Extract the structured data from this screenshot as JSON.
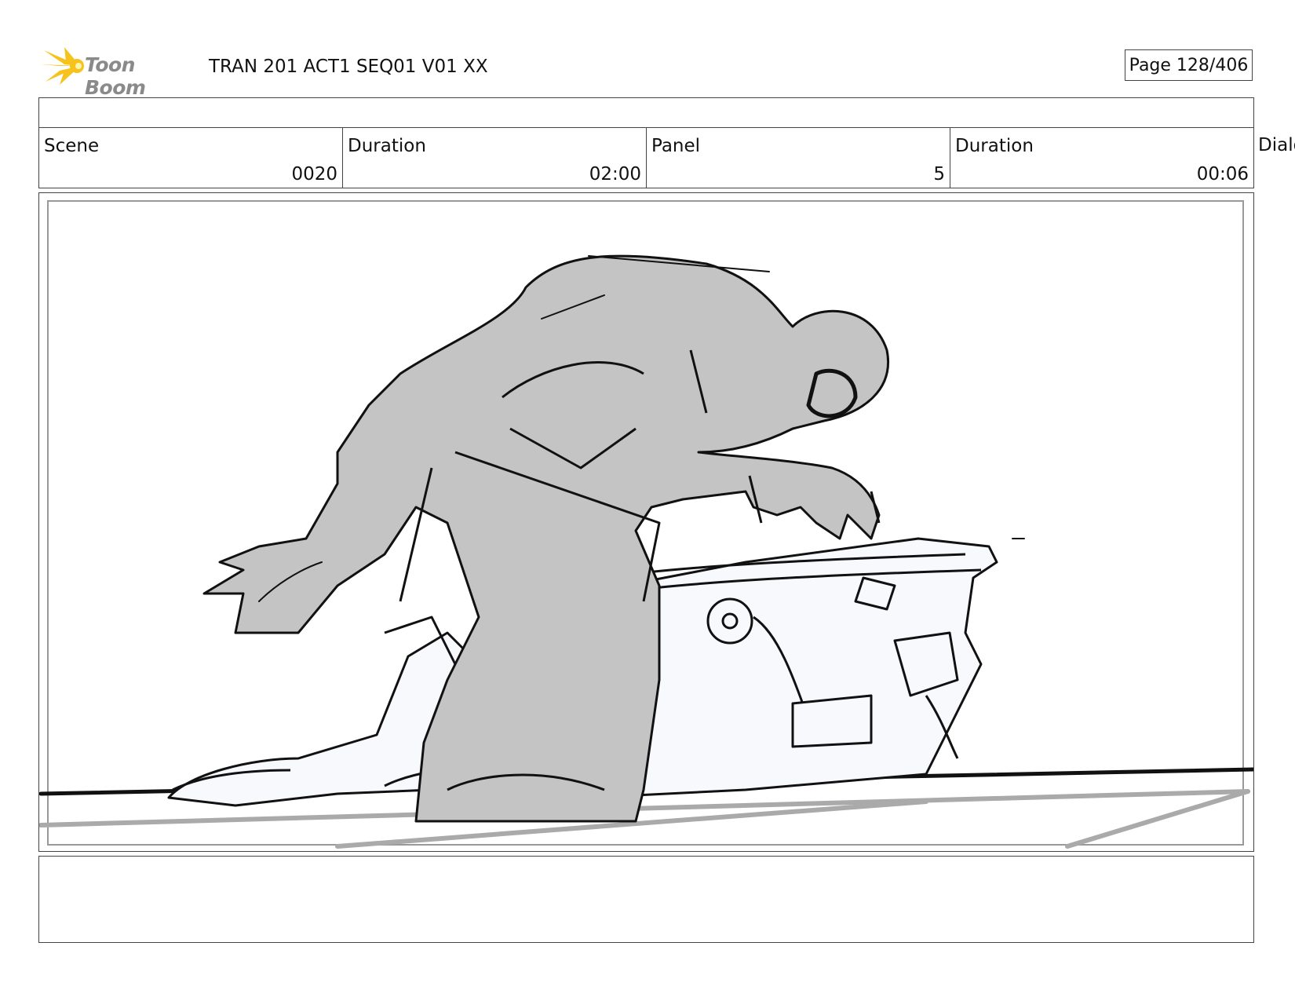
{
  "header": {
    "logo_text": "Toon Boom",
    "title": "TRAN 201 ACT1 SEQ01 V01 XX",
    "page": "Page 128/406"
  },
  "info": {
    "scene_label": "Scene",
    "scene_value": "0020",
    "duration_label": "Duration",
    "duration_value": "02:00",
    "panel_label": "Panel",
    "panel_value": "5",
    "panel_duration_label": "Duration",
    "panel_duration_value": "00:06",
    "dialog_label": "Dialo"
  },
  "panel": {
    "icon": "storyboard-sketch",
    "colors": {
      "figure": "#c4c4c4",
      "robot": "#f7f9fd",
      "line": "#111111",
      "frame": "#999999"
    }
  },
  "logo_colors": {
    "burst": "#f6c21c",
    "text": "#8a8a8a"
  }
}
